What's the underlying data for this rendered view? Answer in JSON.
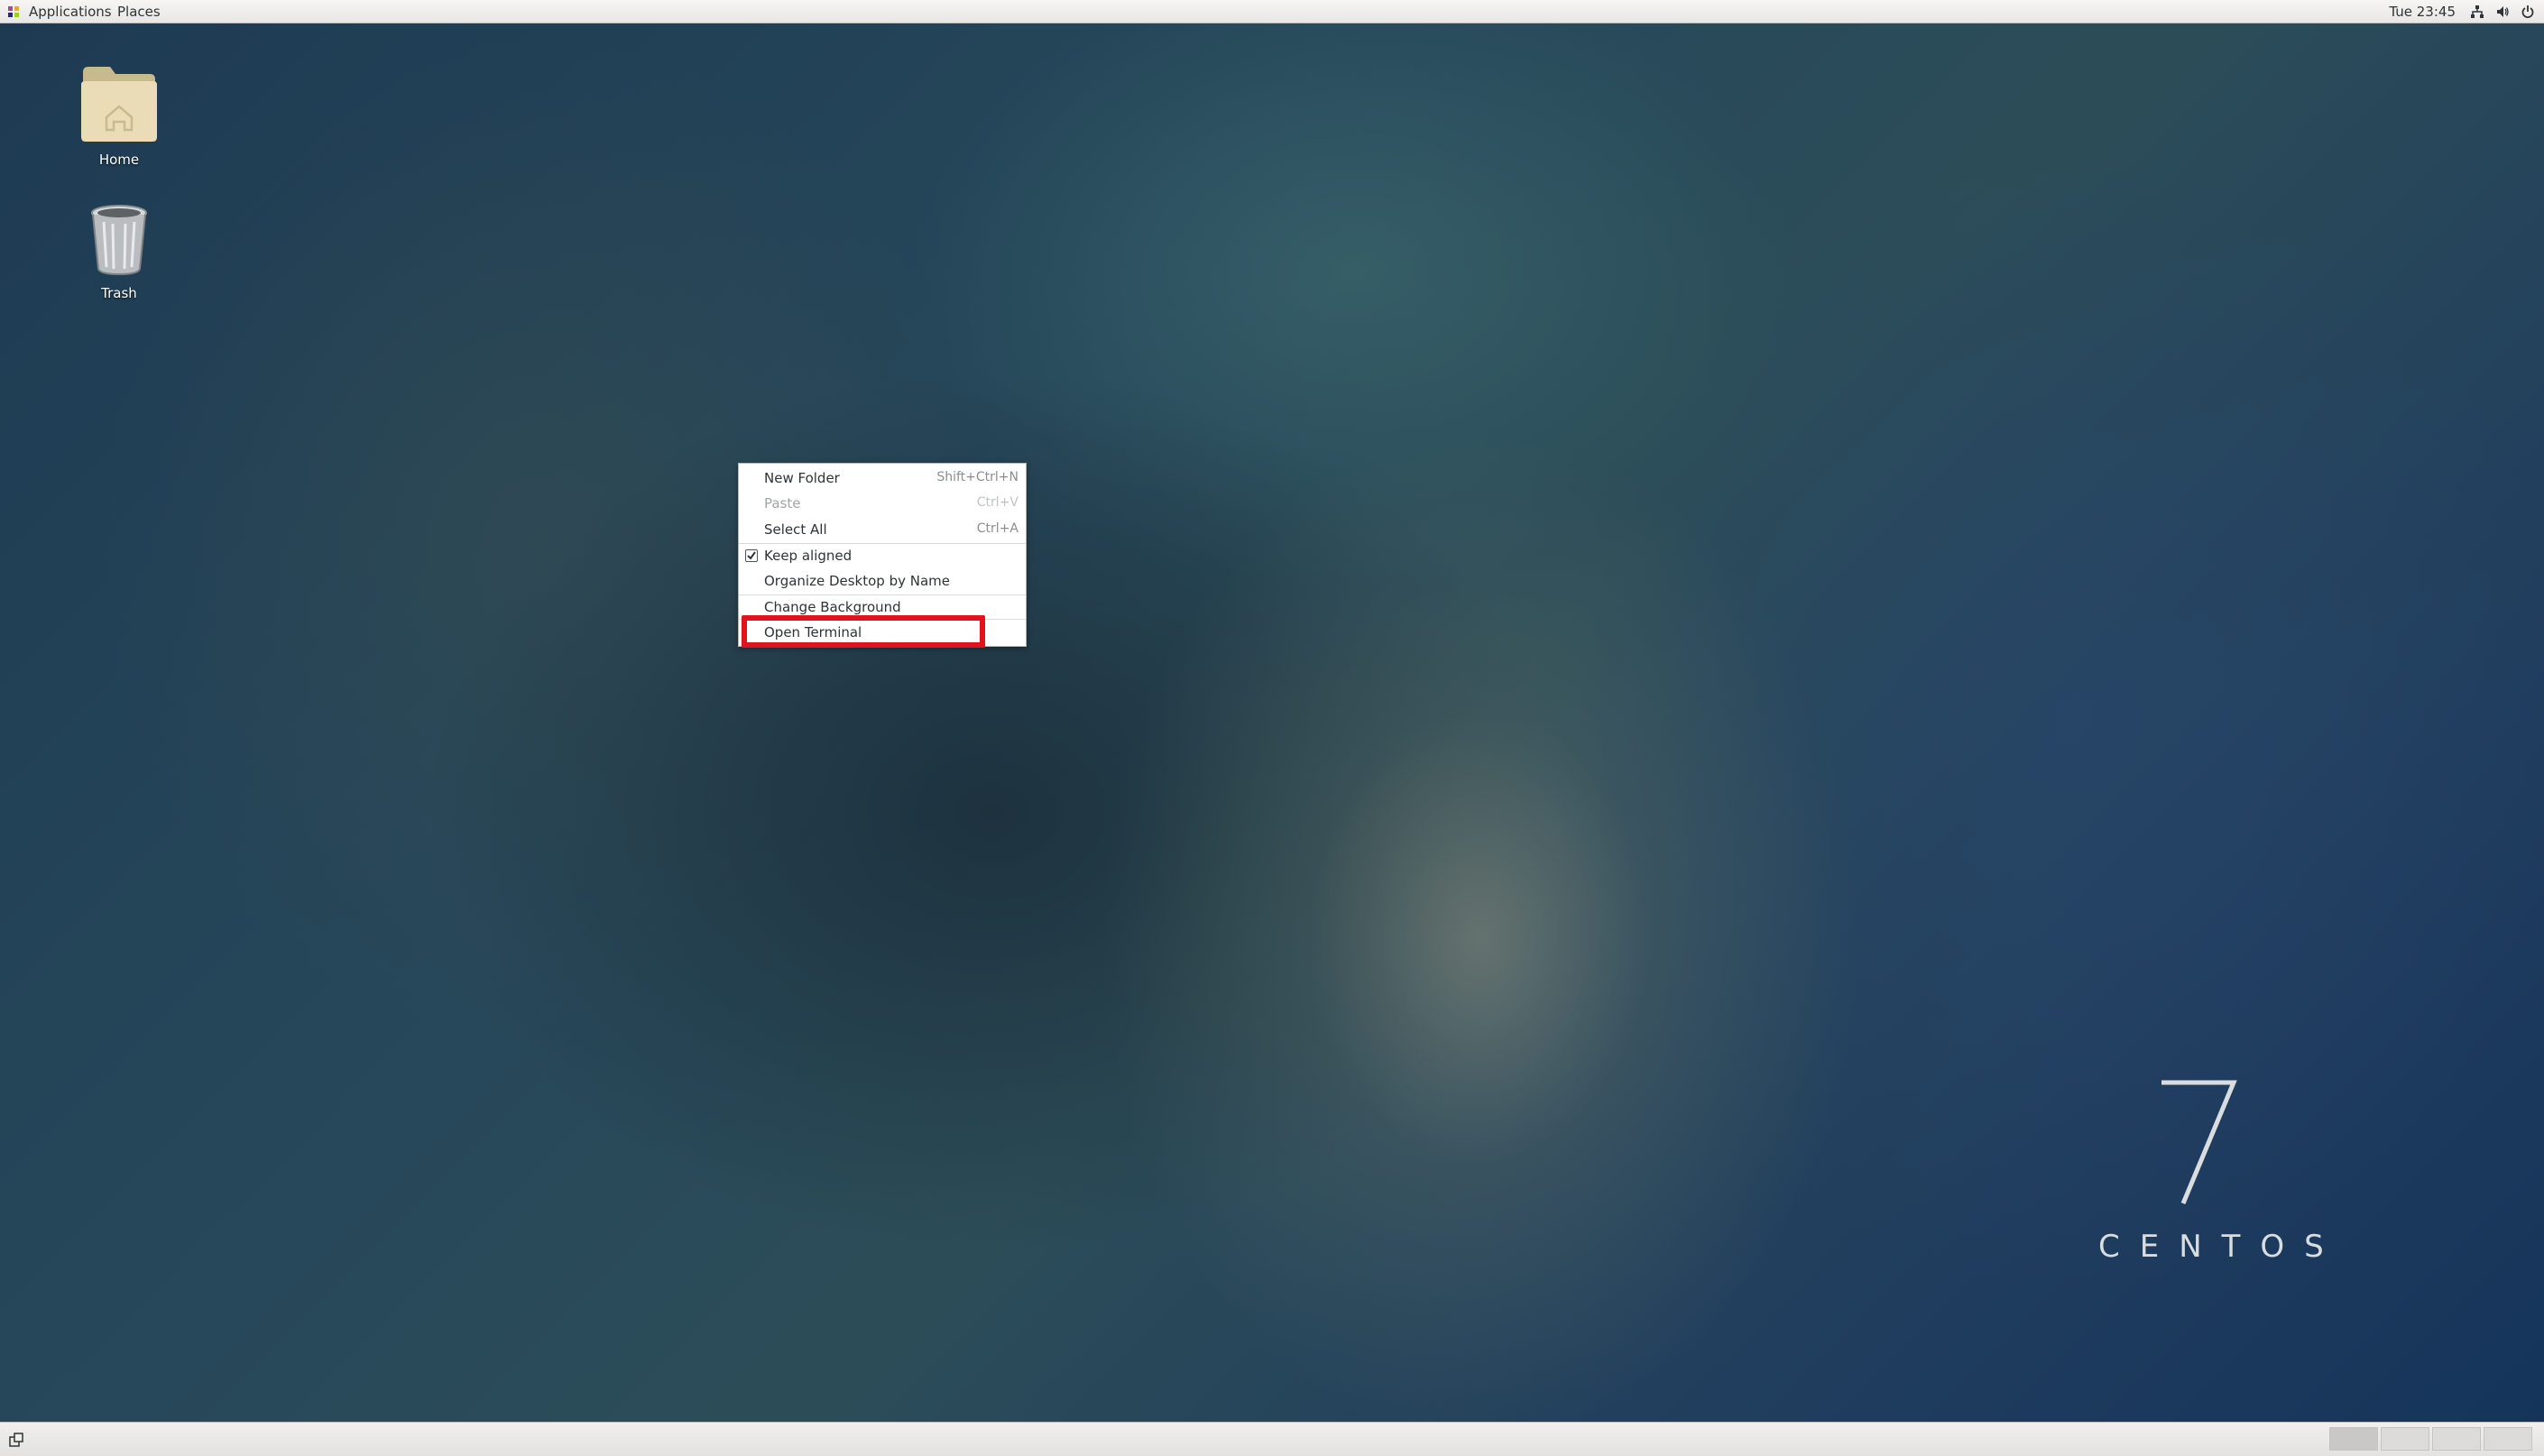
{
  "topbar": {
    "applications": "Applications",
    "places": "Places",
    "clock": "Tue 23:45"
  },
  "desktop_icons": {
    "home": "Home",
    "trash": "Trash"
  },
  "context_menu": {
    "items": [
      {
        "label": "New Folder",
        "accel": "Shift+Ctrl+N",
        "enabled": true
      },
      {
        "label": "Paste",
        "accel": "Ctrl+V",
        "enabled": false
      },
      {
        "label": "Select All",
        "accel": "Ctrl+A",
        "enabled": true
      },
      {
        "label": "Keep aligned",
        "accel": "",
        "checked": true
      },
      {
        "label": "Organize Desktop by Name",
        "accel": ""
      },
      {
        "label": "Change Background",
        "accel": ""
      },
      {
        "label": "Open Terminal",
        "accel": ""
      }
    ],
    "highlighted_item": "Open Terminal",
    "highlight_color": "#e0141b"
  },
  "branding": {
    "version": "7",
    "name": "CENTOS"
  },
  "bottombar": {
    "workspaces": 4,
    "active_workspace": 1
  }
}
